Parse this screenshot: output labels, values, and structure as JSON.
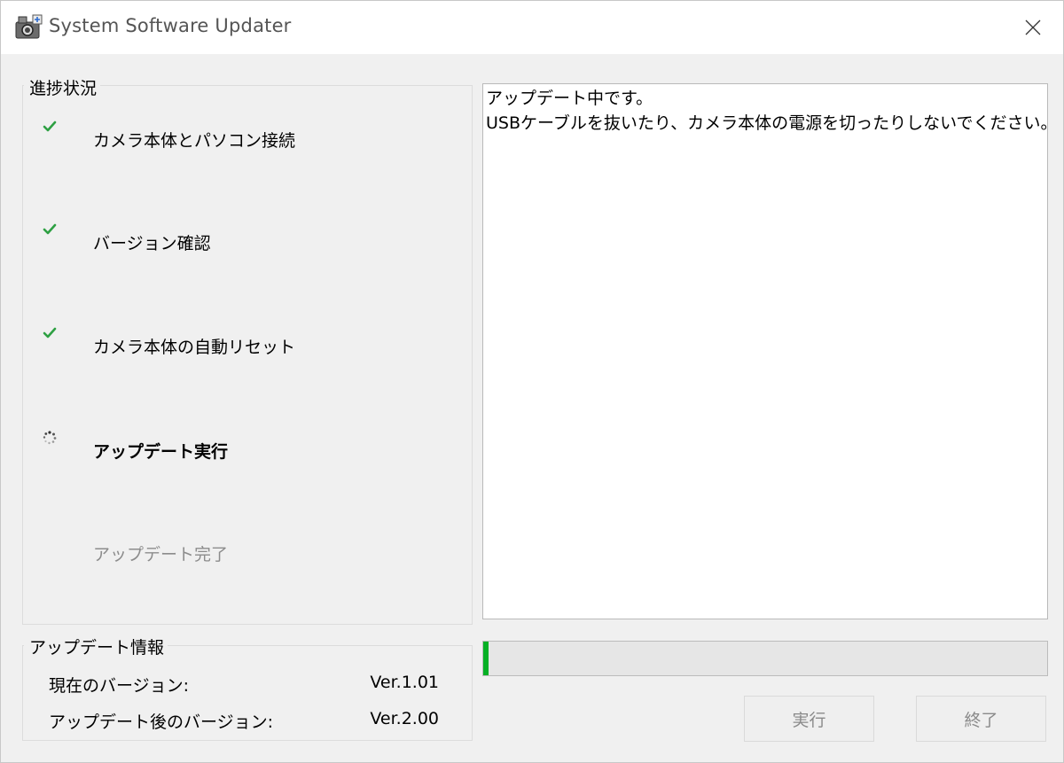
{
  "window": {
    "title": "System Software Updater"
  },
  "progress": {
    "legend": "進捗状況",
    "steps": [
      {
        "label": "カメラ本体とパソコン接続",
        "state": "done",
        "icon": "check-icon"
      },
      {
        "label": "バージョン確認",
        "state": "done",
        "icon": "check-icon"
      },
      {
        "label": "カメラ本体の自動リセット",
        "state": "done",
        "icon": "check-icon"
      },
      {
        "label": "アップデート実行",
        "state": "active",
        "icon": "spinner-icon"
      },
      {
        "label": "アップデート完了",
        "state": "pending",
        "icon": ""
      }
    ]
  },
  "update_info": {
    "legend": "アップデート情報",
    "current_label": "現在のバージョン:",
    "current_value": "Ver.1.01",
    "after_label": "アップデート後のバージョン:",
    "after_value": "Ver.2.00"
  },
  "message": {
    "line1": "アップデート中です。",
    "line2": "USBケーブルを抜いたり、カメラ本体の電源を切ったりしないでください。"
  },
  "progress_bar": {
    "percent": 1
  },
  "buttons": {
    "run": "実行",
    "exit": "終了"
  },
  "colors": {
    "check": "#2ea043",
    "progress_fill": "#06b025"
  }
}
